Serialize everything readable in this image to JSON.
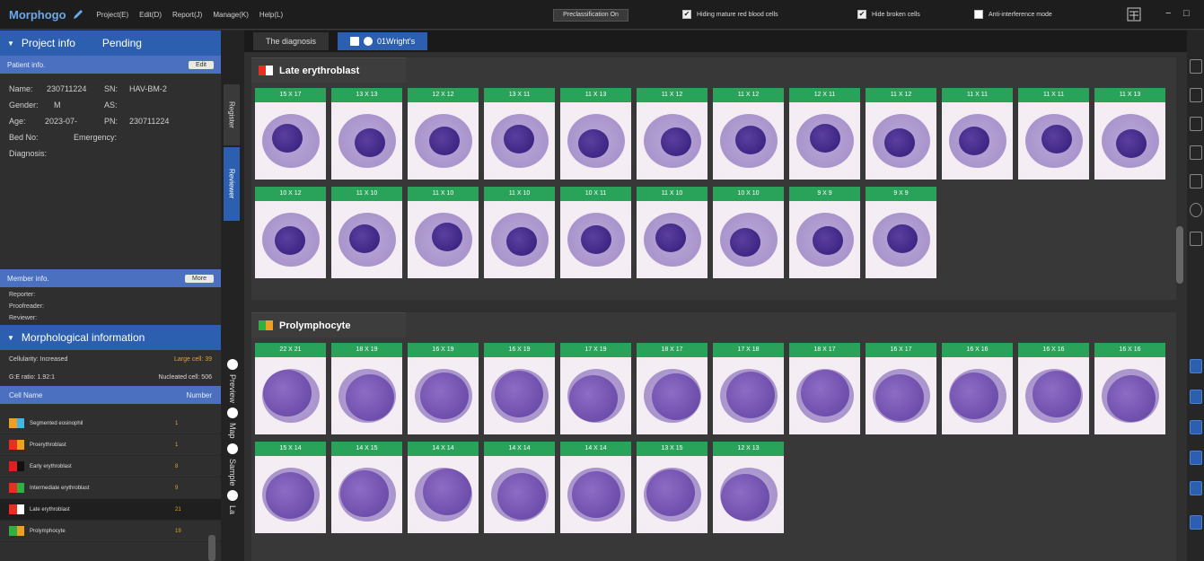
{
  "app": {
    "logo": "Morphogo",
    "menus": [
      "Project(E)",
      "Edit(D)",
      "Report(J)",
      "Manage(K)",
      "Help(L)"
    ],
    "preclass": "Preclassification On",
    "checks": [
      {
        "label": "Hiding mature red blood cells",
        "checked": true
      },
      {
        "label": "Hide broken cells",
        "checked": true
      },
      {
        "label": "Anti-interference mode",
        "checked": false
      }
    ],
    "window": {
      "minimize": "−",
      "maximize": "□"
    }
  },
  "left": {
    "project": {
      "title": "Project info",
      "status": "Pending"
    },
    "patient": {
      "title": "Patient info.",
      "edit": "Edit"
    },
    "fields": {
      "name_label": "Name:",
      "name": "230711224",
      "sn_label": "SN:",
      "sn": "HAV-BM-2",
      "gender_label": "Gender:",
      "gender": "M",
      "as_label": "AS:",
      "age_label": "Age:",
      "age": "2023-07-",
      "pn_label": "PN:",
      "pn": "230711224",
      "bed_label": "Bed No:",
      "emergency_label": "Emergency:",
      "diagnosis_label": "Diagnosis:"
    },
    "member": {
      "title": "Member info.",
      "more": "More",
      "reporter": "Reporter:",
      "proofreader": "Proofreader:",
      "reviewer": "Reviewer:"
    },
    "morph": {
      "title": "Morphological information",
      "cellularity": "Cellularity: Increased",
      "large_cell": "Large cell: 39",
      "ge_ratio": "G:E ratio: 1.92:1",
      "nucleated": "Nucleated cell: 506"
    },
    "cell_table": {
      "name_header": "Cell Name",
      "number_header": "Number",
      "rows": [
        {
          "name": "Segmented eosinophil",
          "number": "1",
          "c1": "#f0a020",
          "c2": "#3fb8e8"
        },
        {
          "name": "Proerythroblast",
          "number": "1",
          "c1": "#e83020",
          "c2": "#f0a020"
        },
        {
          "name": "Early erythroblast",
          "number": "8",
          "c1": "#e02020",
          "c2": "#111111"
        },
        {
          "name": "Intermediate erythroblast",
          "number": "9",
          "c1": "#e83020",
          "c2": "#2fb040"
        },
        {
          "name": "Late erythroblast",
          "number": "21",
          "c1": "#e83020",
          "c2": "#ffffff"
        },
        {
          "name": "Prolymphocyte",
          "number": "19",
          "c1": "#2fb040",
          "c2": "#f0a020"
        }
      ]
    }
  },
  "vtabs": {
    "register": "Register",
    "review": "Reviewer",
    "preview": "Preview",
    "map": "Map",
    "sample": "Sample",
    "last": "La"
  },
  "main": {
    "tabs": {
      "diagnosis": "The diagnosis",
      "stain": "01Wright's"
    },
    "sections": [
      {
        "title": "Late erythroblast",
        "flag": [
          "#e83020",
          "#ffffff"
        ],
        "cells": [
          "15 X 17",
          "13 X 13",
          "12 X 12",
          "13 X 11",
          "11 X 13",
          "11 X 12",
          "11 X 12",
          "12 X 11",
          "11 X 12",
          "11 X 11",
          "11 X 11",
          "11 X 13",
          "10 X 12",
          "11 X 10",
          "11 X 10",
          "11 X 10",
          "10 X 11",
          "11 X 10",
          "10 X 10",
          "9 X 9",
          "9 X 9"
        ]
      },
      {
        "title": "Prolymphocyte",
        "flag": [
          "#2fb040",
          "#f0a020"
        ],
        "cells": [
          "22 X 21",
          "18 X 19",
          "16 X 19",
          "16 X 19",
          "17 X 19",
          "18 X 17",
          "17 X 18",
          "18 X 17",
          "16 X 17",
          "16 X 16",
          "16 X 16",
          "16 X 16",
          "15 X 14",
          "14 X 15",
          "14 X 14",
          "14 X 14",
          "14 X 14",
          "13 X 15",
          "12 X 13"
        ]
      }
    ]
  }
}
